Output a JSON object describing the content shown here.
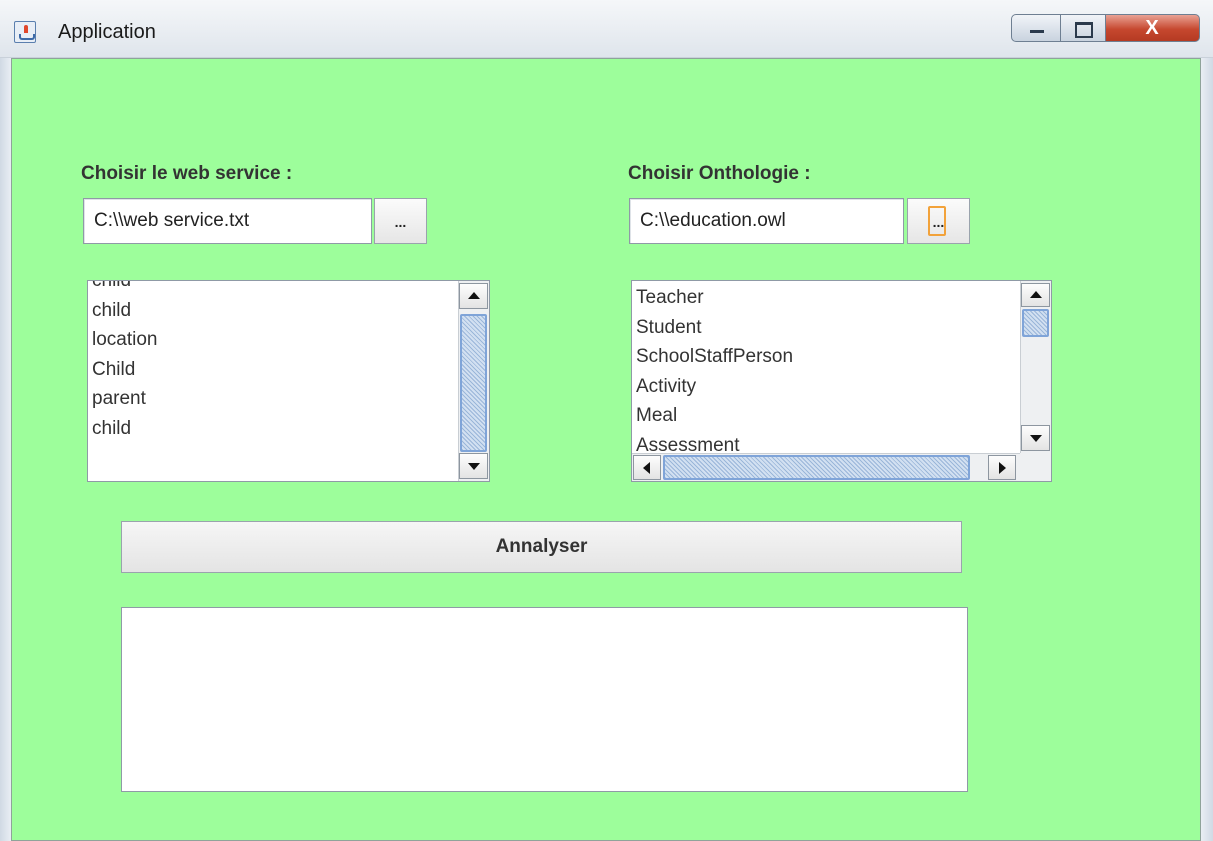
{
  "window": {
    "title": "Application",
    "close_label": "X"
  },
  "web_service": {
    "label": "Choisir le web service :",
    "path_value": "C:\\\\web service.txt",
    "browse_label": "...",
    "items": [
      "child",
      "child",
      "location",
      "Child",
      "parent",
      "child"
    ]
  },
  "ontology": {
    "label": "Choisir Onthologie :",
    "path_value": "C:\\\\education.owl",
    "browse_label": "...",
    "items": [
      "Teacher",
      "Student",
      "SchoolStaffPerson",
      "Activity",
      "Meal",
      "Assessment"
    ]
  },
  "analyze": {
    "button_label": "Annalyser",
    "result_text": ""
  },
  "colors": {
    "panel_background": "#9dfe9b",
    "focus_ring": "#f2a23a",
    "scroll_thumb": "#bcd0ea"
  }
}
